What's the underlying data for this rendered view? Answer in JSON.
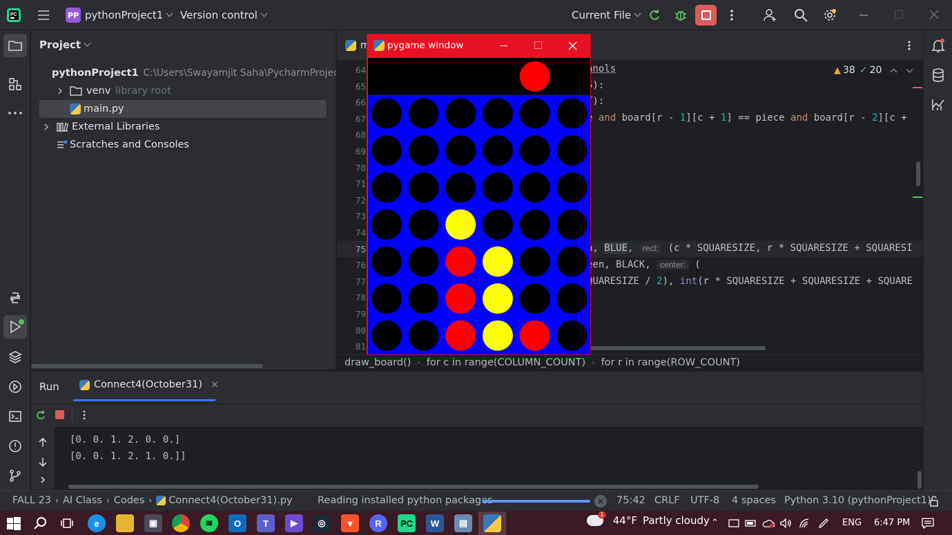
{
  "titlebar": {
    "project_badge": "PP",
    "project_name": "pythonProject1",
    "vcs": "Version control",
    "run_config": "Current File"
  },
  "project_panel": {
    "title": "Project",
    "root_name": "pythonProject1",
    "root_path": "C:\\Users\\Swayamjit Saha\\PycharmProjec",
    "venv": "venv",
    "venv_hint": "library root",
    "main_file": "main.py",
    "external": "External Libraries",
    "scratches": "Scratches and Consoles"
  },
  "editor": {
    "tab_partial": "m",
    "warnings": "38",
    "checks": "20",
    "lines": [
      "64",
      "65",
      "66",
      "67",
      "68",
      "69",
      "70",
      "71",
      "72",
      "73",
      "74",
      "75",
      "76",
      "77",
      "78",
      "79",
      "80",
      "81"
    ],
    "code_frag_64": "anols",
    "code_frag_65": "5):",
    "code_frag_66": "T):",
    "code_67_a": "e ",
    "code_67_and1": "and",
    "code_67_b": " board[r - ",
    "code_67_n1": "1",
    "code_67_c": "][c + ",
    "code_67_n2": "1",
    "code_67_d": "] == piece ",
    "code_67_and2": "and",
    "code_67_e": " board[r - ",
    "code_67_n3": "2",
    "code_67_f": "][c + ",
    "code_75_a": "n, ",
    "code_75_blue": "BLUE",
    "code_75_b": ", ",
    "code_75_hint": "rect:",
    "code_75_c": " (c * SQUARESIZE, r * SQUARESIZE + SQUARESI",
    "code_76_a": "een, BLACK, ",
    "code_76_hint": "center:",
    "code_76_b": " (",
    "code_77_a": "QUARESIZE / ",
    "code_77_n": "2",
    "code_77_b": "), ",
    "code_77_int": "int",
    "code_77_c": "(r * SQUARESIZE + SQUARESIZE + SQUARE",
    "breadcrumb": [
      "draw_board()",
      "for c in range(COLUMN_COUNT)",
      "for r in range(ROW_COUNT)"
    ]
  },
  "pygame": {
    "title": "pygame window",
    "top_piece_col": 4,
    "board": [
      [
        0,
        0,
        0,
        0,
        0,
        0
      ],
      [
        0,
        0,
        0,
        0,
        0,
        0
      ],
      [
        0,
        0,
        0,
        0,
        0,
        0
      ],
      [
        0,
        0,
        2,
        0,
        0,
        0
      ],
      [
        0,
        0,
        1,
        2,
        0,
        0
      ],
      [
        0,
        0,
        1,
        2,
        0,
        0
      ],
      [
        0,
        0,
        1,
        2,
        1,
        0
      ]
    ],
    "colors": {
      "red": "#ff0000",
      "yellow": "#ffff00",
      "blue": "#0000ff",
      "black": "#000000"
    }
  },
  "run_panel": {
    "tab_run": "Run",
    "tab_config": "Connect4(October31)",
    "output": [
      "[0. 0. 1. 2. 0. 0.]",
      "[0. 0. 1. 2. 1. 0.]]"
    ]
  },
  "statusbar": {
    "crumbs": [
      "FALL 23",
      "AI Class",
      "Codes",
      "Connect4(October31).py"
    ],
    "task": "Reading installed python packages",
    "progress": 1.0,
    "position": "75:42",
    "line_sep": "CRLF",
    "encoding": "UTF-8",
    "indent": "4 spaces",
    "interpreter": "Python 3.10 (pythonProject1)"
  },
  "taskbar": {
    "weather_temp": "44°F",
    "weather_desc": "Partly cloudy",
    "weather_badge": "1",
    "lang": "ENG",
    "time": "6:47 PM"
  }
}
